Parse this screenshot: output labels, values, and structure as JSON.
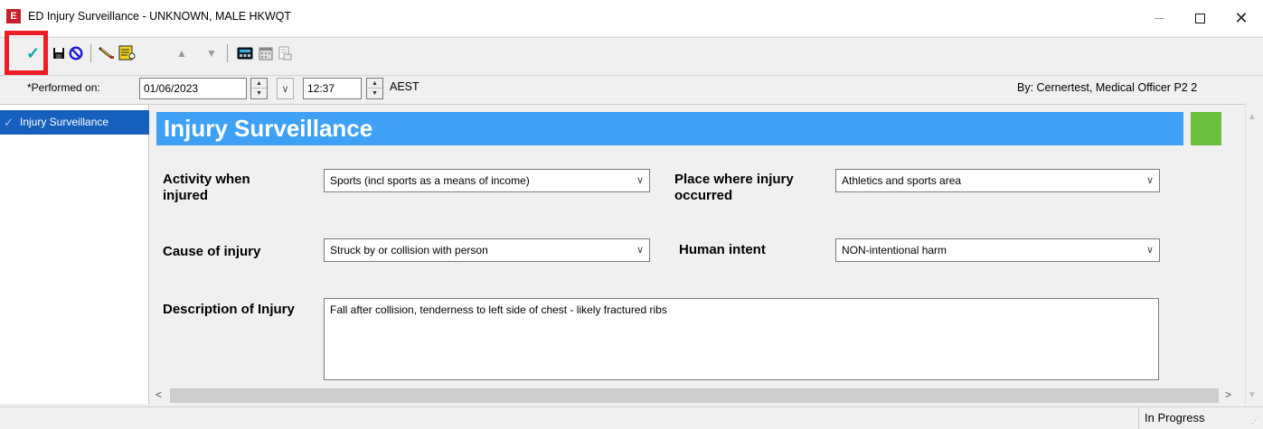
{
  "window": {
    "app_icon_letter": "E",
    "title": "ED Injury Surveillance - UNKNOWN, MALE HKWQT",
    "minimize": "",
    "close": "✕"
  },
  "toolbar": {
    "icons": [
      "sign-checkmark-icon",
      "save-icon",
      "cancel-icon",
      "edit-icon",
      "form-browser-icon",
      "move-up-icon",
      "move-down-icon",
      "calculator-icon",
      "calendar-icon",
      "print-preview-icon"
    ]
  },
  "performed": {
    "label": "*Performed on:",
    "date": "01/06/2023",
    "time": "12:37",
    "timezone": "AEST",
    "by": "By:  Cernertest, Medical Officer P2 2"
  },
  "nav": {
    "items": [
      {
        "label": "Injury Surveillance"
      }
    ]
  },
  "form": {
    "banner_title": "Injury Surveillance",
    "activity": {
      "label": "Activity when injured",
      "value": "Sports (incl sports as a means of income)"
    },
    "place": {
      "label": "Place where injury occurred",
      "value": "Athletics and sports area"
    },
    "cause": {
      "label": "Cause of injury",
      "value": "Struck by or collision with person"
    },
    "intent": {
      "label": "Human intent",
      "value": "NON-intentional harm"
    },
    "description": {
      "label": "Description of Injury",
      "value": "Fall after collision, tenderness to left side of chest - likely fractured ribs"
    }
  },
  "status": {
    "text": "In Progress"
  },
  "colors": {
    "banner": "#3fa1f6",
    "status_indicator": "#6cbf3c",
    "nav_selected": "#1560bd",
    "highlight": "#ee1c25"
  }
}
